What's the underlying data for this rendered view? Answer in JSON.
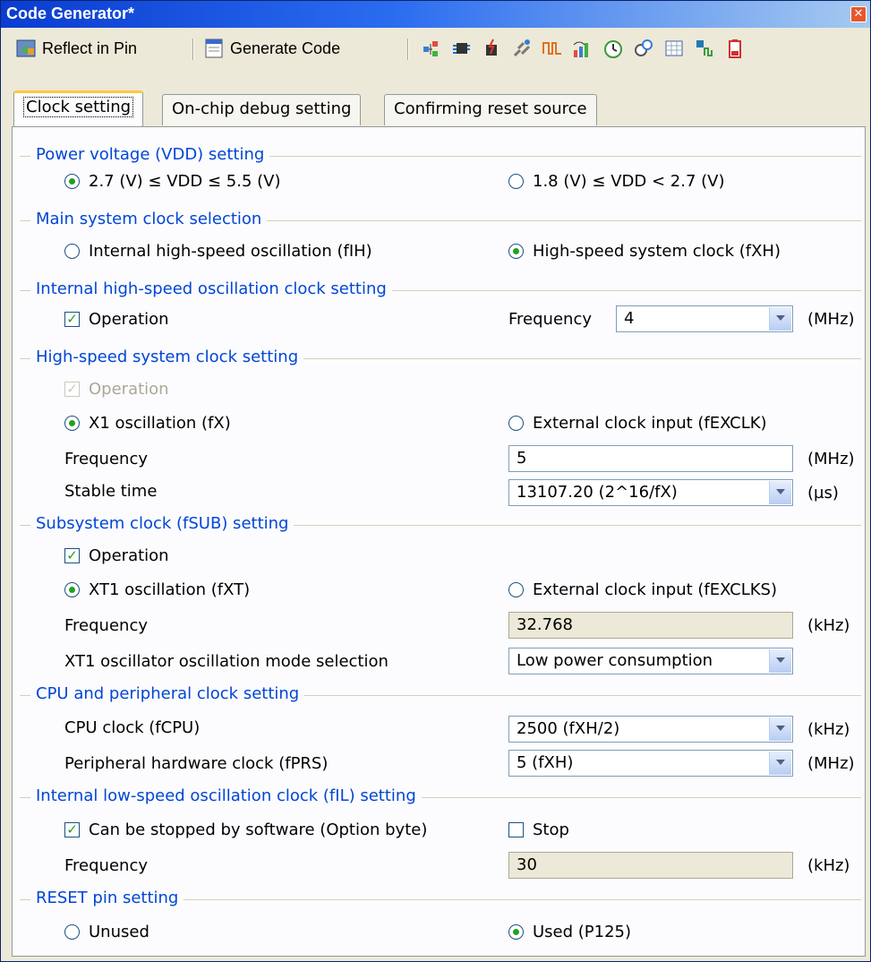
{
  "window": {
    "title": "Code Generator*"
  },
  "toolbar": {
    "reflect_label": "Reflect in Pin",
    "generate_label": "Generate Code",
    "icons": [
      "pin-map-icon",
      "chip-icon",
      "interrupt-icon",
      "serial-icon",
      "pwm-icon",
      "adc-icon",
      "timer-icon",
      "watchdog-icon",
      "table-icon",
      "signal-icon",
      "battery-icon"
    ]
  },
  "tabs": [
    "Clock setting",
    "On-chip debug setting",
    "Confirming reset source"
  ],
  "groups": {
    "power": "Power voltage (VDD) setting",
    "main": "Main system clock selection",
    "internal_high": "Internal high-speed oscillation clock setting",
    "high_speed": "High-speed system clock setting",
    "subsystem": "Subsystem clock (fSUB) setting",
    "cpu": "CPU and peripheral clock setting",
    "internal_low": "Internal low-speed oscillation clock (fIL) setting",
    "reset": "RESET pin setting"
  },
  "power": {
    "opt1": "2.7 (V) ≤ VDD ≤ 5.5 (V)",
    "opt2": "1.8 (V) ≤ VDD < 2.7 (V)"
  },
  "main": {
    "opt1": "Internal high-speed oscillation (fIH)",
    "opt2": "High-speed system clock (fXH)"
  },
  "internal_high": {
    "operation": "Operation",
    "freq_label": "Frequency",
    "freq_value": "4",
    "unit": "(MHz)"
  },
  "high_speed": {
    "operation": "Operation",
    "opt1": "X1 oscillation (fX)",
    "opt2": "External clock input (fEXCLK)",
    "freq_label": "Frequency",
    "freq_value": "5",
    "freq_unit": "(MHz)",
    "stable_label": "Stable time",
    "stable_value": "13107.20 (2^16/fX)",
    "stable_unit": "(µs)"
  },
  "subsystem": {
    "operation": "Operation",
    "opt1": "XT1 oscillation (fXT)",
    "opt2": "External clock input (fEXCLKS)",
    "freq_label": "Frequency",
    "freq_value": "32.768",
    "freq_unit": "(kHz)",
    "mode_label": "XT1 oscillator oscillation mode selection",
    "mode_value": "Low power consumption"
  },
  "cpu": {
    "cpu_label": "CPU clock (fCPU)",
    "cpu_value": "2500 (fXH/2)",
    "cpu_unit": "(kHz)",
    "prs_label": "Peripheral hardware clock (fPRS)",
    "prs_value": "5 (fXH)",
    "prs_unit": "(MHz)"
  },
  "internal_low": {
    "stop_sw": "Can be stopped by software (Option byte)",
    "stop": "Stop",
    "freq_label": "Frequency",
    "freq_value": "30",
    "freq_unit": "(kHz)"
  },
  "reset": {
    "opt1": "Unused",
    "opt2": "Used (P125)"
  }
}
